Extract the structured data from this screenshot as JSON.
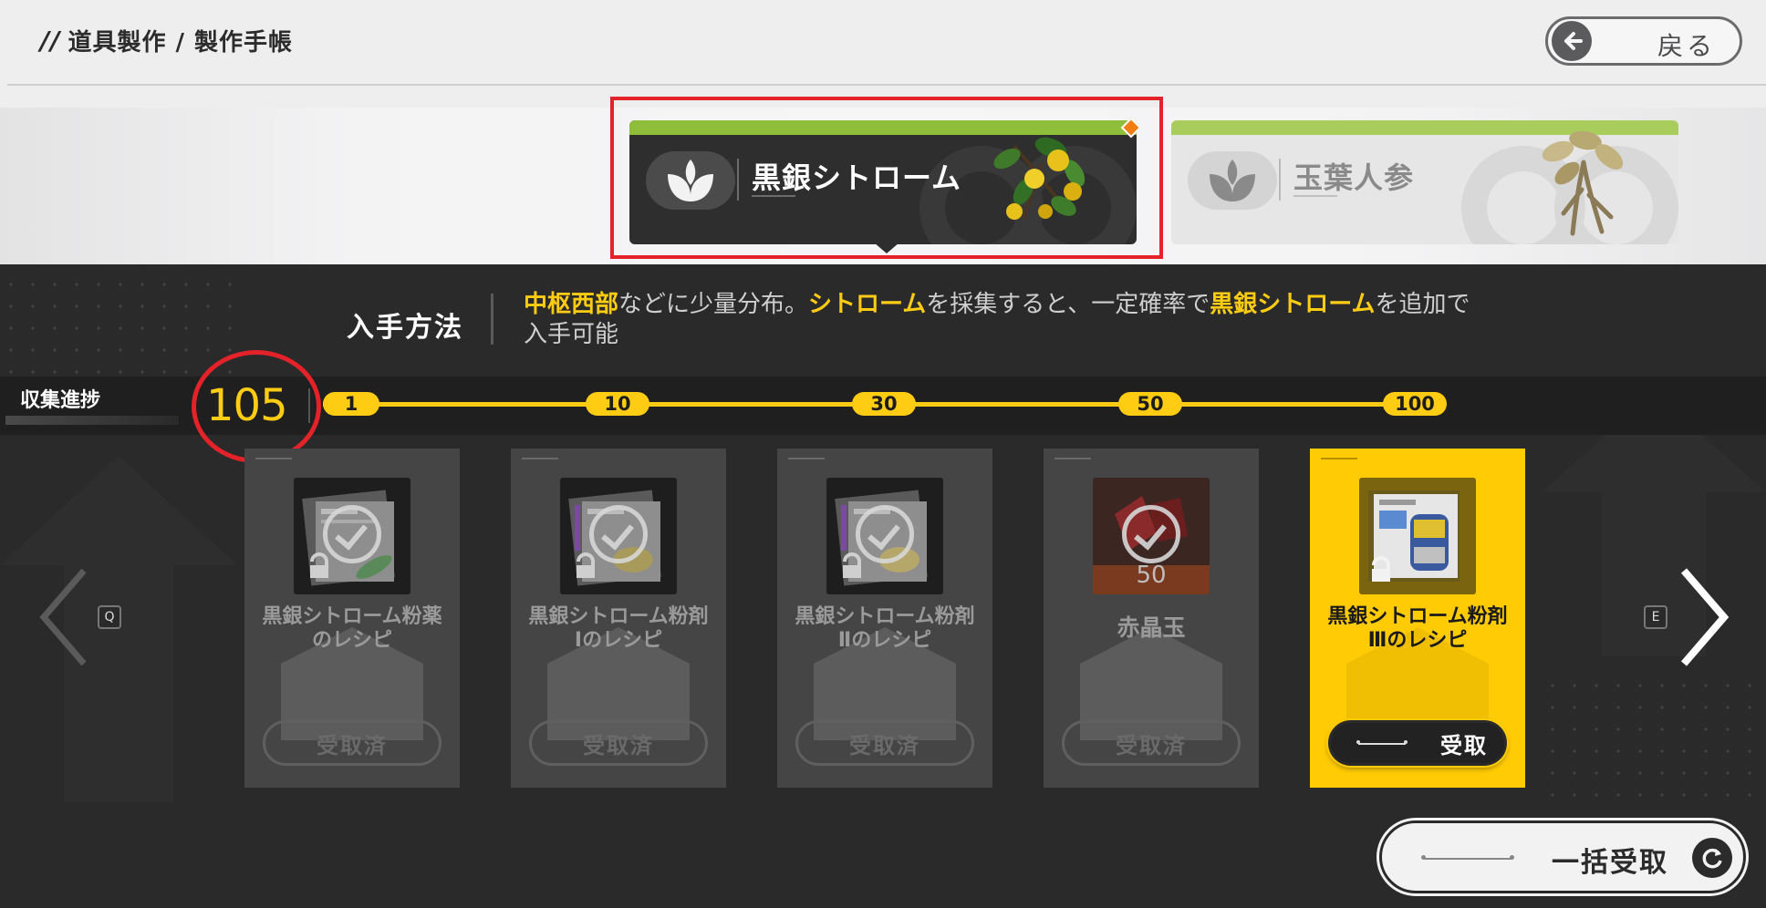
{
  "header": {
    "slashes": "//",
    "breadcrumb": "道具製作 / 製作手帳",
    "back_label": "戻る"
  },
  "materials": [
    {
      "name": "黒銀シトローム",
      "selected": true
    },
    {
      "name": "玉葉人参",
      "selected": false
    }
  ],
  "acquisition": {
    "title": "入手方法",
    "parts": [
      {
        "text": "中枢西部",
        "highlight": true
      },
      {
        "text": "などに少量分布。",
        "highlight": false
      },
      {
        "text": "シトローム",
        "highlight": true
      },
      {
        "text": "を採集すると、一定確率で",
        "highlight": false
      },
      {
        "text": "黒銀シトローム",
        "highlight": true
      },
      {
        "text": "を追加で入手可能",
        "highlight": false
      }
    ]
  },
  "progress": {
    "label": "収集進捗",
    "count": "105",
    "milestones": [
      "1",
      "10",
      "30",
      "50",
      "100"
    ]
  },
  "rewards": [
    {
      "name_line1": "黒銀シトローム粉薬",
      "name_line2": "のレシピ",
      "button": "受取済",
      "claimed": true
    },
    {
      "name_line1": "黒銀シトローム粉剤",
      "name_line2": "Ⅰのレシピ",
      "button": "受取済",
      "claimed": true
    },
    {
      "name_line1": "黒銀シトローム粉剤",
      "name_line2": "Ⅱのレシピ",
      "button": "受取済",
      "claimed": true
    },
    {
      "name_line1": "赤晶玉",
      "name_line2": "",
      "button": "受取済",
      "claimed": true,
      "qty": "50"
    },
    {
      "name_line1": "黒銀シトローム粉剤",
      "name_line2": "Ⅲのレシピ",
      "button": "受取",
      "claimed": false
    }
  ],
  "nav": {
    "prev_key": "Q",
    "next_key": "E"
  },
  "bulk_claim": {
    "label": "一括受取"
  },
  "colors": {
    "accent": "#ffcc14",
    "selection": "#e3222a",
    "leaf_bar": "#8fbf3a"
  }
}
